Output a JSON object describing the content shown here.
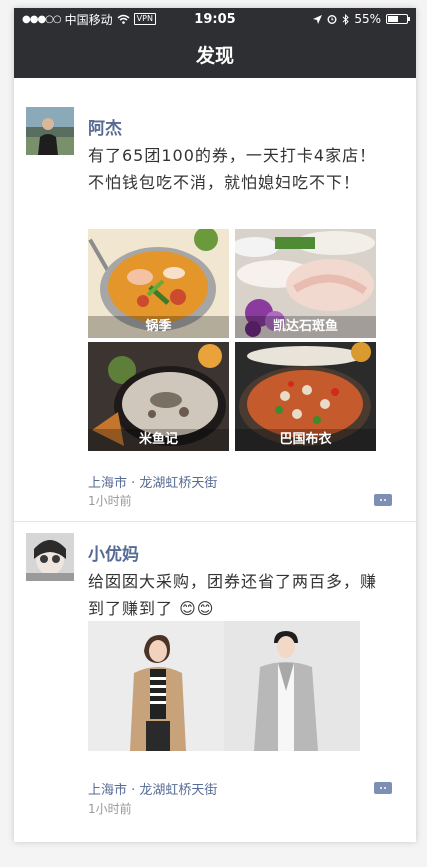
{
  "status_bar": {
    "signal": "●●●○○",
    "carrier": "中国移动",
    "vpn": "VPN",
    "time": "19:05",
    "battery": "55%",
    "battery_level": 0.55
  },
  "nav": {
    "title": "发现"
  },
  "posts": [
    {
      "author": "阿杰",
      "text": "有了65团100的券，一天打卡4家店！不怕钱包吃不消，就怕媳妇吃不下！",
      "photos": [
        {
          "caption": "锅季"
        },
        {
          "caption": "凯达石斑鱼"
        },
        {
          "caption": "米鱼记"
        },
        {
          "caption": "巴国布衣"
        }
      ],
      "location": "上海市 · 龙湖虹桥天街",
      "time": "1小时前"
    },
    {
      "author": "小优妈",
      "text": "给囡囡大采购，团券还省了两百多，赚到了赚到了 😊😊",
      "location": "上海市 · 龙湖虹桥天街",
      "time": "1小时前"
    }
  ],
  "colors": {
    "bar": "#2e2f33",
    "link": "#576b95",
    "comment_icon": "#7d8fb4"
  }
}
